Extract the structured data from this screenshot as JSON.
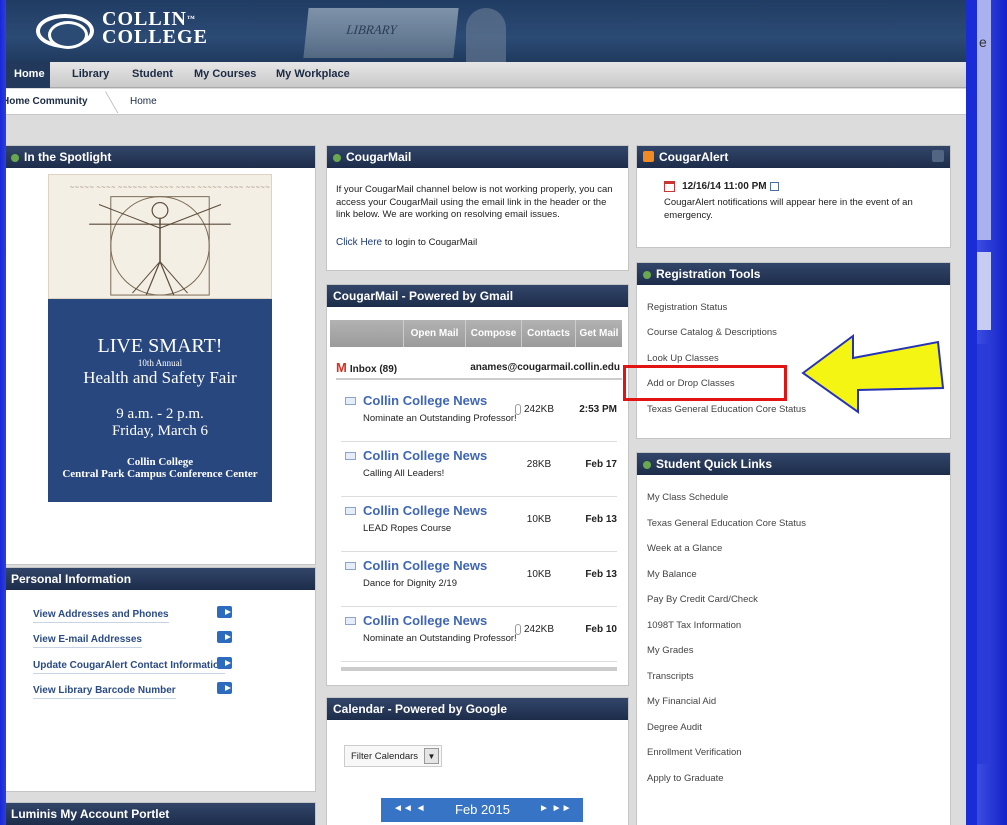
{
  "header": {
    "logo_line1": "COLLIN",
    "logo_line2": "COLLEGE",
    "tm": "™",
    "banner_text": "LIBRARY"
  },
  "nav": {
    "items": [
      "Home",
      "Library",
      "Student",
      "My Courses",
      "My Workplace"
    ]
  },
  "breadcrumb": {
    "community": "Home Community",
    "current": "Home"
  },
  "spotlight": {
    "title": "In the Spotlight",
    "poster_title": "LIVE SMART!",
    "poster_annual": "10th Annual",
    "poster_fair": "Health and Safety Fair",
    "poster_time": "9 a.m. - 2 p.m.",
    "poster_day": "Friday, March 6",
    "poster_college": "Collin College",
    "poster_location": "Central Park Campus Conference Center"
  },
  "personal": {
    "title": "Personal Information",
    "links": [
      "View Addresses and Phones",
      "View E-mail Addresses",
      "Update CougarAlert Contact Information",
      "View Library Barcode Number"
    ]
  },
  "luminis": {
    "title": "Luminis My Account Portlet"
  },
  "cougarmail": {
    "title": "CougarMail",
    "notice": "If your CougarMail channel below is not working properly, you can access your CougarMail using the email link in the header or the link below.  We are working on resolving email issues.",
    "click_here": "Click Here",
    "login_text": " to login to CougarMail"
  },
  "gmail": {
    "title": "CougarMail - Powered by Gmail",
    "buttons": [
      "Open Mail",
      "Compose",
      "Contacts",
      "Get Mail"
    ],
    "inbox": "Inbox (89)",
    "address": "anames@cougarmail.collin.edu",
    "messages": [
      {
        "from": "Collin College News",
        "subject": "Nominate an Outstanding Professor!",
        "size": "242KB",
        "date": "2:53 PM"
      },
      {
        "from": "Collin College News",
        "subject": "Calling All Leaders!",
        "size": "28KB",
        "date": "Feb 17"
      },
      {
        "from": "Collin College News",
        "subject": "LEAD Ropes Course",
        "size": "10KB",
        "date": "Feb 13"
      },
      {
        "from": "Collin College News",
        "subject": "Dance for Dignity 2/19",
        "size": "10KB",
        "date": "Feb 13"
      },
      {
        "from": "Collin College News",
        "subject": "Nominate an Outstanding Professor!",
        "size": "242KB",
        "date": "Feb 10"
      }
    ]
  },
  "calendar": {
    "title": "Calendar - Powered by Google",
    "filter": "Filter Calendars",
    "month": "Feb 2015",
    "prev": "◄◄  ◄",
    "next": "►  ►►"
  },
  "alert": {
    "title": "CougarAlert",
    "datetime": "12/16/14 11:00 PM",
    "text": "CougarAlert notifications will appear here in the event of an emergency."
  },
  "registration": {
    "title": "Registration Tools",
    "links": [
      "Registration Status",
      "Course Catalog & Descriptions",
      "Look Up Classes",
      "Add or Drop Classes",
      "Texas General Education Core Status"
    ]
  },
  "quicklinks": {
    "title": "Student Quick Links",
    "links": [
      "My Class Schedule",
      "Texas General Education Core Status",
      "Week at a Glance",
      "My Balance",
      "Pay By Credit Card/Check",
      "1098T Tax Information",
      "My Grades",
      "Transcripts",
      "My Financial Aid",
      "Degree Audit",
      "Enrollment Verification",
      "Apply to Graduate"
    ]
  },
  "external": {
    "edge_letter": "e"
  },
  "colors": {
    "accent": "#23395c",
    "highlight": "#e31313",
    "arrow": "#f5f514",
    "frame": "#1a2cd6"
  }
}
